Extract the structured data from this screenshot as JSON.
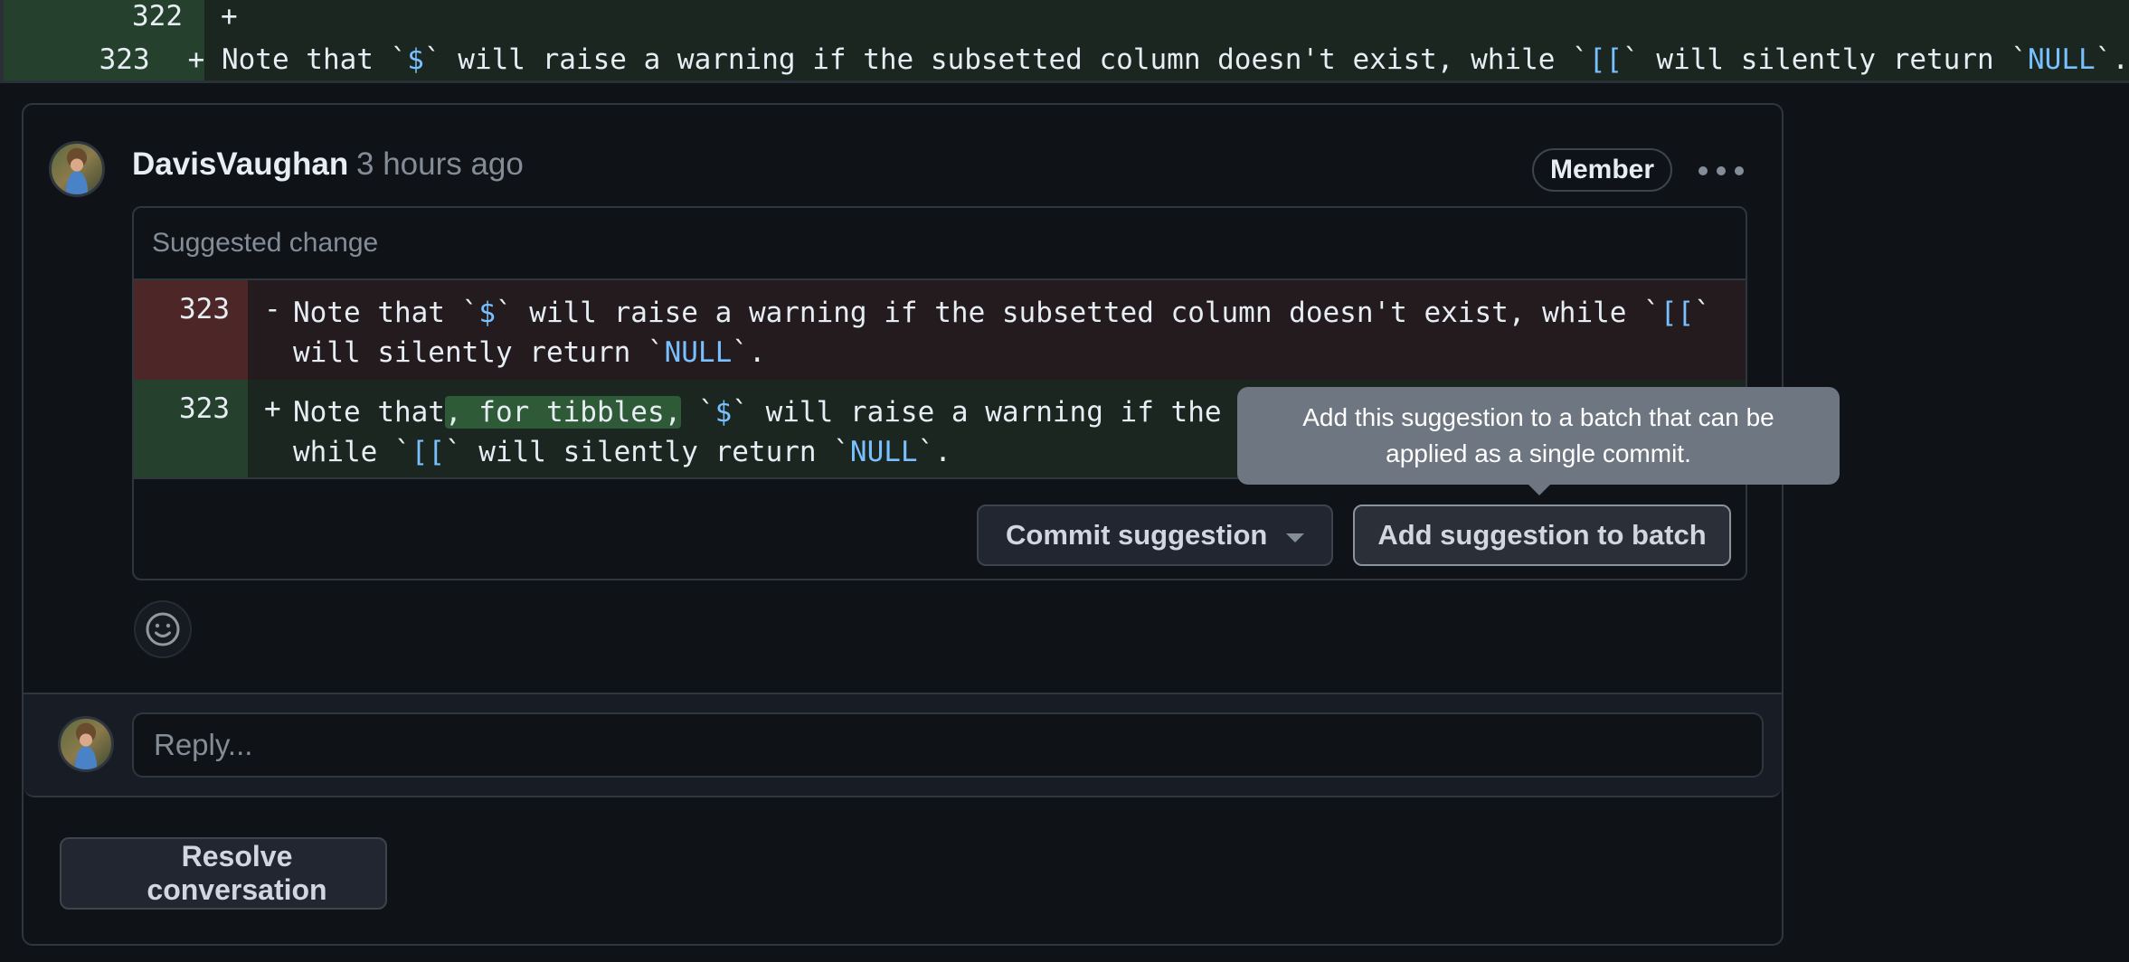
{
  "top_diff": {
    "lines": [
      {
        "number": "322",
        "sign": "+",
        "segments": [
          {
            "text": "",
            "code": false
          }
        ]
      },
      {
        "number": "323",
        "sign": "+",
        "segments": [
          {
            "text": "Note that `",
            "code": false
          },
          {
            "text": "$",
            "code": true
          },
          {
            "text": "` will raise a warning if the subsetted column doesn't exist, while `",
            "code": false
          },
          {
            "text": "[[",
            "code": true
          },
          {
            "text": "` will silently return `",
            "code": false
          },
          {
            "text": "NULL",
            "code": true
          },
          {
            "text": "`.",
            "code": false
          }
        ]
      }
    ]
  },
  "comment": {
    "author": "DavisVaughan",
    "timestamp": "3 hours ago",
    "badge": "Member",
    "more_icon": "kebab-horizontal-icon",
    "suggested_change": {
      "header": "Suggested change",
      "removed": {
        "number": "323",
        "sign": "-",
        "line1": [
          {
            "text": "Note that `",
            "code": false
          },
          {
            "text": "$",
            "code": true
          },
          {
            "text": "` will raise a warning if the subsetted column doesn't exist, while `",
            "code": false
          },
          {
            "text": "[[",
            "code": true
          },
          {
            "text": "`",
            "code": false
          }
        ],
        "line2": [
          {
            "text": "will silently return `",
            "code": false
          },
          {
            "text": "NULL",
            "code": true
          },
          {
            "text": "`.",
            "code": false
          }
        ]
      },
      "added": {
        "number": "323",
        "sign": "+",
        "line1": [
          {
            "text": "Note that",
            "code": false
          },
          {
            "text": ", for tibbles,",
            "inserted": true
          },
          {
            "text": " `",
            "code": false
          },
          {
            "text": "$",
            "code": true
          },
          {
            "text": "` will raise a warning if the subsetted column doesn't exist,",
            "code": false
          }
        ],
        "line2": [
          {
            "text": "while `",
            "code": false
          },
          {
            "text": "[[",
            "code": true
          },
          {
            "text": "` will silently return `",
            "code": false
          },
          {
            "text": "NULL",
            "code": true
          },
          {
            "text": "`.",
            "code": false
          }
        ]
      },
      "commit_button": "Commit suggestion",
      "batch_button": "Add suggestion to batch",
      "tooltip": "Add this suggestion to a batch that can be applied as a single commit."
    },
    "reaction_icon": "smiley-icon"
  },
  "reply": {
    "placeholder": "Reply..."
  },
  "resolve_button": "Resolve conversation",
  "colors": {
    "background": "#0f1217",
    "added_bg": "#1b2621",
    "added_gutter": "#26402e",
    "removed_bg": "#241b1f",
    "removed_gutter": "#4d2727",
    "inserted_highlight": "#2f5a37",
    "code_accent": "#79c0ff",
    "tooltip_bg": "#6e7681",
    "muted_text": "#848d97"
  }
}
